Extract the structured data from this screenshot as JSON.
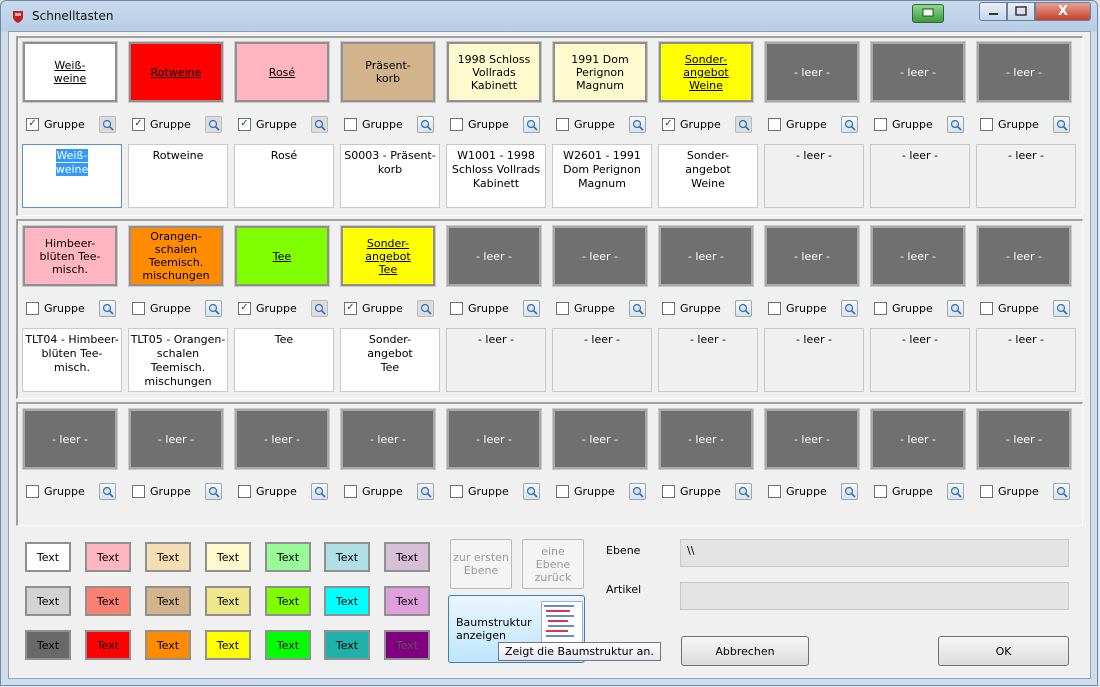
{
  "window": {
    "title": "Schnelltasten",
    "close_glyph": "X"
  },
  "rows": [
    {
      "buttons": [
        {
          "label": "Weiß-\nweine",
          "bg": "#ffffff",
          "underline": true
        },
        {
          "label": "Rotweine",
          "bg": "#ff0000",
          "underline": true
        },
        {
          "label": "Rosé",
          "bg": "#ffb6c1",
          "underline": true
        },
        {
          "label": "Präsent-\nkorb",
          "bg": "#d2b48c",
          "underline": false
        },
        {
          "label": "1998 Schloss\nVollrads\nKabinett",
          "bg": "#fffacd",
          "underline": false
        },
        {
          "label": "1991 Dom\nPerignon\nMagnum",
          "bg": "#fffacd",
          "underline": false
        },
        {
          "label": "Sonder-\nangebot\nWeine",
          "bg": "#ffff00",
          "underline": true
        },
        {
          "label": "- leer -",
          "bg": "#707070",
          "underline": false
        },
        {
          "label": "- leer -",
          "bg": "#707070",
          "underline": false
        },
        {
          "label": "- leer -",
          "bg": "#707070",
          "underline": false
        }
      ],
      "groups": [
        true,
        true,
        true,
        false,
        false,
        false,
        true,
        false,
        false,
        false
      ],
      "texts": [
        "Weiß-\nweine",
        "Rotweine",
        "Rosé",
        "S0003 - Präsent-\nkorb",
        "W1001 - 1998\nSchloss Vollrads\nKabinett",
        "W2601 - 1991\nDom Perignon\nMagnum",
        "Sonder-\nangebot\nWeine",
        "- leer -",
        "- leer -",
        "- leer -"
      ]
    },
    {
      "buttons": [
        {
          "label": "Himbeer-\nblüten Tee-\nmisch.",
          "bg": "#ffb6c1",
          "underline": false
        },
        {
          "label": "Orangen-\nschalen\nTeemisch.\nmischungen",
          "bg": "#ff8c00",
          "underline": false
        },
        {
          "label": "Tee",
          "bg": "#7fff00",
          "underline": true
        },
        {
          "label": "Sonder-\nangebot\nTee",
          "bg": "#ffff00",
          "underline": true
        },
        {
          "label": "- leer -",
          "bg": "#707070",
          "underline": false
        },
        {
          "label": "- leer -",
          "bg": "#707070",
          "underline": false
        },
        {
          "label": "- leer -",
          "bg": "#707070",
          "underline": false
        },
        {
          "label": "- leer -",
          "bg": "#707070",
          "underline": false
        },
        {
          "label": "- leer -",
          "bg": "#707070",
          "underline": false
        },
        {
          "label": "- leer -",
          "bg": "#707070",
          "underline": false
        }
      ],
      "groups": [
        false,
        false,
        true,
        true,
        false,
        false,
        false,
        false,
        false,
        false
      ],
      "texts": [
        "TLT04 - Himbeer-\nblüten Tee-\nmisch.",
        "TLT05 - Orangen-\nschalen\nTeemisch.\nmischungen",
        "Tee",
        "Sonder-\nangebot\nTee",
        "- leer -",
        "- leer -",
        "- leer -",
        "- leer -",
        "- leer -",
        "- leer -"
      ]
    },
    {
      "buttons": [
        {
          "label": "- leer -",
          "bg": "#707070",
          "underline": false
        },
        {
          "label": "- leer -",
          "bg": "#707070",
          "underline": false
        },
        {
          "label": "- leer -",
          "bg": "#707070",
          "underline": false
        },
        {
          "label": "- leer -",
          "bg": "#707070",
          "underline": false
        },
        {
          "label": "- leer -",
          "bg": "#707070",
          "underline": false
        },
        {
          "label": "- leer -",
          "bg": "#707070",
          "underline": false
        },
        {
          "label": "- leer -",
          "bg": "#707070",
          "underline": false
        },
        {
          "label": "- leer -",
          "bg": "#707070",
          "underline": false
        },
        {
          "label": "- leer -",
          "bg": "#707070",
          "underline": false
        },
        {
          "label": "- leer -",
          "bg": "#707070",
          "underline": false
        }
      ],
      "groups": [
        false,
        false,
        false,
        false,
        false,
        false,
        false,
        false,
        false,
        false
      ],
      "texts": []
    }
  ],
  "group_label": "Gruppe",
  "palette": {
    "label": "Text",
    "colors": [
      [
        "#ffffff",
        "#ffb6c1",
        "#f5deb3",
        "#fffacd",
        "#98fb98",
        "#b0e0e6",
        "#d8bfd8"
      ],
      [
        "#d3d3d3",
        "#fa8072",
        "#d2b48c",
        "#f0e68c",
        "#7fff00",
        "#00ffff",
        "#dda0dd"
      ],
      [
        "#696969",
        "#ff0000",
        "#ff8c00",
        "#ffff00",
        "#00ff00",
        "#20b2aa",
        "#800080"
      ]
    ]
  },
  "nav": {
    "first_level": "zur ersten\nEbene",
    "level_back": "eine\nEbene\nzurück",
    "tree_button": "Baumstruktur\nanzeigen",
    "tooltip": "Zeigt die Baumstruktur an."
  },
  "fields": {
    "level_label": "Ebene",
    "level_value": "\\\\",
    "article_label": "Artikel",
    "article_value": ""
  },
  "actions": {
    "cancel": "Abbrechen",
    "ok": "OK"
  }
}
